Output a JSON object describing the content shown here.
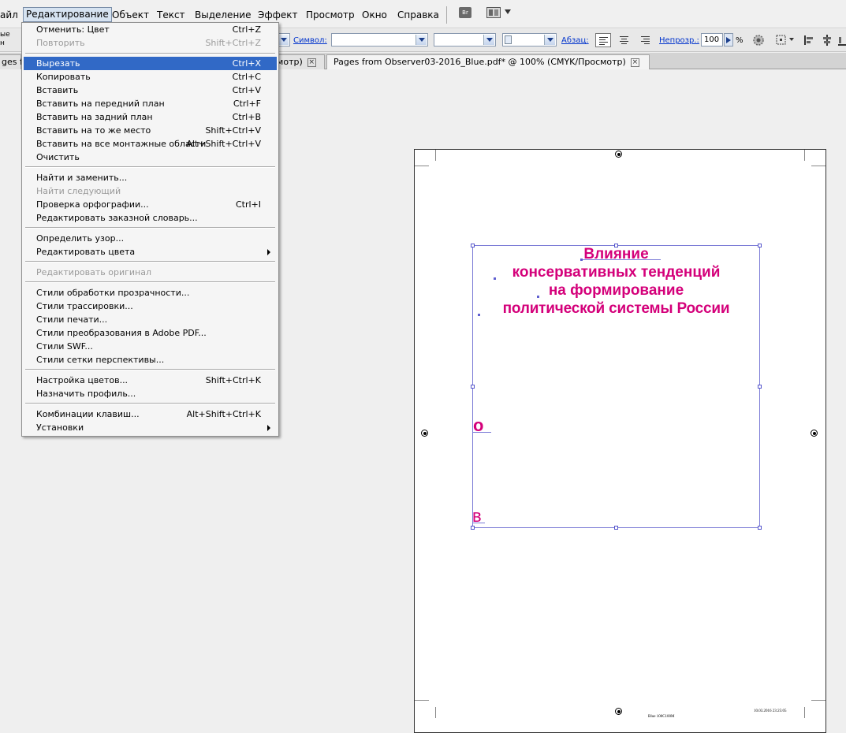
{
  "menubar": {
    "items": [
      "айл",
      "Редактирование",
      "Объект",
      "Текст",
      "Выделение",
      "Эффект",
      "Просмотр",
      "Окно",
      "Справка"
    ],
    "bridge_label": "Br"
  },
  "control_bar": {
    "cut_label_1": "ые",
    "cut_label_2": "н",
    "symbol_label": "Символ:",
    "paragraph_label": "Абзац:",
    "opacity_label": "Непрозр.:",
    "opacity_value": "100",
    "percent": "%"
  },
  "tabs": [
    {
      "label": "ges f"
    },
    {
      "label": "смотр)"
    },
    {
      "label": "Pages from Observer03-2016_Blue.pdf* @ 100% (CMYK/Просмотр)"
    }
  ],
  "tab_close": "×",
  "edit_menu": {
    "items": [
      {
        "label": "Отменить: Цвет",
        "shortcut": "Ctrl+Z"
      },
      {
        "label": "Повторить",
        "shortcut": "Shift+Ctrl+Z"
      },
      {
        "label": "Вырезать",
        "shortcut": "Ctrl+X"
      },
      {
        "label": "Копировать",
        "shortcut": "Ctrl+C"
      },
      {
        "label": "Вставить",
        "shortcut": "Ctrl+V"
      },
      {
        "label": "Вставить на передний план",
        "shortcut": "Ctrl+F"
      },
      {
        "label": "Вставить на задний план",
        "shortcut": "Ctrl+B"
      },
      {
        "label": "Вставить на то же место",
        "shortcut": "Shift+Ctrl+V"
      },
      {
        "label": "Вставить на все монтажные области",
        "shortcut": "Alt+Shift+Ctrl+V"
      },
      {
        "label": "Очистить",
        "shortcut": ""
      },
      {
        "label": "Найти и заменить...",
        "shortcut": ""
      },
      {
        "label": "Найти следующий",
        "shortcut": ""
      },
      {
        "label": "Проверка орфографии...",
        "shortcut": "Ctrl+I"
      },
      {
        "label": "Редактировать заказной словарь...",
        "shortcut": ""
      },
      {
        "label": "Определить узор...",
        "shortcut": ""
      },
      {
        "label": "Редактировать цвета",
        "shortcut": ""
      },
      {
        "label": "Редактировать оригинал",
        "shortcut": ""
      },
      {
        "label": "Стили обработки прозрачности...",
        "shortcut": ""
      },
      {
        "label": "Стили трассировки...",
        "shortcut": ""
      },
      {
        "label": "Стили печати...",
        "shortcut": ""
      },
      {
        "label": "Стили преобразования в Adobe PDF...",
        "shortcut": ""
      },
      {
        "label": "Стили SWF...",
        "shortcut": ""
      },
      {
        "label": "Стили сетки перспективы...",
        "shortcut": ""
      },
      {
        "label": "Настройка цветов...",
        "shortcut": "Shift+Ctrl+K"
      },
      {
        "label": "Назначить профиль...",
        "shortcut": ""
      },
      {
        "label": "Комбинации клавиш...",
        "shortcut": "Alt+Shift+Ctrl+K"
      },
      {
        "label": "Установки",
        "shortcut": ""
      }
    ]
  },
  "document": {
    "title_lines": [
      "Влияние",
      "консервативных тенденций",
      "на формирование",
      "политической системы России"
    ],
    "letter_o": "о",
    "letter_v": "в",
    "slug_left": "Blue 100C100M",
    "slug_right": "10.03.2016   23:25:05"
  },
  "colors": {
    "title_magenta": "#d4007a",
    "selection_blue": "#7b7bd6",
    "menu_highlight": "#3169c6"
  }
}
